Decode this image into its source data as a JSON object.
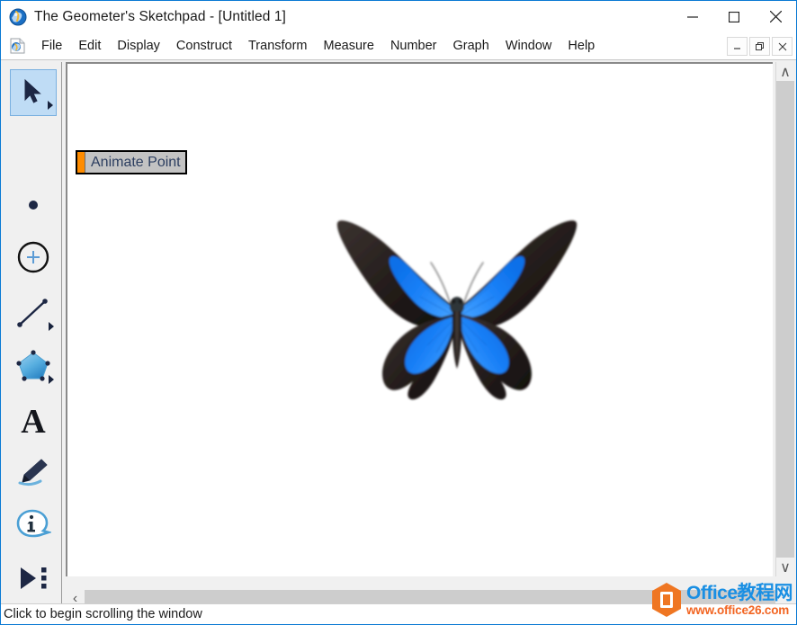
{
  "window": {
    "title": "The Geometer's Sketchpad - [Untitled 1]",
    "app_icon": "sketchpad-globe-icon",
    "controls": [
      {
        "name": "minimize-button",
        "glyph": "—"
      },
      {
        "name": "maximize-button",
        "glyph": "☐"
      },
      {
        "name": "close-button",
        "glyph": "✕"
      }
    ],
    "accent_border": "#0a7ad4"
  },
  "menubar": {
    "doc_icon": "document-icon",
    "items": [
      {
        "label": "File"
      },
      {
        "label": "Edit"
      },
      {
        "label": "Display"
      },
      {
        "label": "Construct"
      },
      {
        "label": "Transform"
      },
      {
        "label": "Measure"
      },
      {
        "label": "Number"
      },
      {
        "label": "Graph"
      },
      {
        "label": "Window"
      },
      {
        "label": "Help"
      }
    ],
    "mdi_controls": [
      {
        "name": "mdi-minimize-button",
        "glyph": "–"
      },
      {
        "name": "mdi-restore-button",
        "glyph": "❐"
      },
      {
        "name": "mdi-close-button",
        "glyph": "✕"
      }
    ]
  },
  "toolbox": {
    "tools": [
      {
        "name": "arrow-select-tool",
        "icon": "arrow-cursor-icon",
        "selected": true,
        "has_flyout": true
      },
      {
        "name": "point-tool",
        "icon": "point-icon",
        "selected": false,
        "has_flyout": false
      },
      {
        "name": "compass-circle-tool",
        "icon": "circle-plus-icon",
        "selected": false,
        "has_flyout": false
      },
      {
        "name": "straightedge-tool",
        "icon": "segment-line-icon",
        "selected": false,
        "has_flyout": true
      },
      {
        "name": "polygon-tool",
        "icon": "pentagon-icon",
        "selected": false,
        "has_flyout": true
      },
      {
        "name": "text-tool",
        "icon": "letter-a-icon",
        "selected": false,
        "has_flyout": false
      },
      {
        "name": "marker-tool",
        "icon": "marker-pen-icon",
        "selected": false,
        "has_flyout": false
      },
      {
        "name": "information-tool",
        "icon": "info-bubble-icon",
        "selected": false,
        "has_flyout": false
      },
      {
        "name": "custom-tool",
        "icon": "play-menu-icon",
        "selected": false,
        "has_flyout": false
      }
    ]
  },
  "canvas": {
    "animate_button": {
      "label": "Animate Point",
      "accent_color": "#ff8c00",
      "face_color": "#c3c3c3",
      "text_color": "#2c3e60"
    },
    "image": {
      "name": "butterfly-image",
      "description": "Blue Ulysses butterfly with black wing borders",
      "wing_color": "#1a7ff5",
      "border_color": "#120d0d"
    }
  },
  "scrollbars": {
    "vertical": {
      "up_glyph": "∧",
      "down_glyph": "∨"
    },
    "horizontal": {
      "left_glyph": "‹",
      "right_glyph": "›"
    }
  },
  "statusbar": {
    "message": "Click to begin scrolling the window"
  },
  "watermark": {
    "site_name": "Office教程网",
    "url": "www.office26.com",
    "logo_color": "#ef7622",
    "name_color": "#1a8fe3"
  }
}
